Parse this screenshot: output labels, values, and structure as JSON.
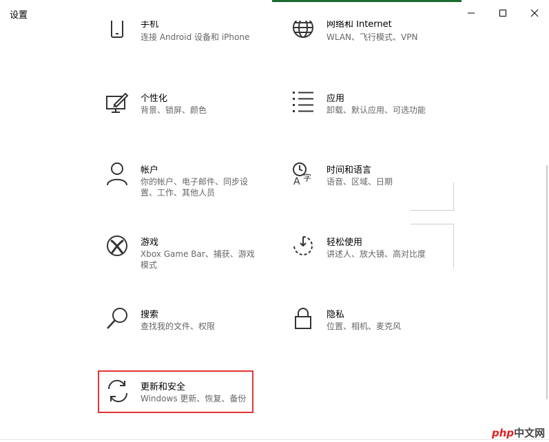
{
  "window": {
    "title": "设置",
    "controls": {
      "minimize": "minimize-icon",
      "maximize": "maximize-icon",
      "close": "close-icon"
    }
  },
  "tiles": [
    {
      "id": "phone",
      "label": "手机",
      "desc": "连接 Android 设备和 iPhone",
      "icon": "phone-icon"
    },
    {
      "id": "network",
      "label": "网络和 Internet",
      "desc": "WLAN、飞行模式、VPN",
      "icon": "globe-icon"
    },
    {
      "id": "personalization",
      "label": "个性化",
      "desc": "背景、锁屏、颜色",
      "icon": "personalization-icon"
    },
    {
      "id": "apps",
      "label": "应用",
      "desc": "卸载、默认应用、可选功能",
      "icon": "apps-list-icon"
    },
    {
      "id": "accounts",
      "label": "帐户",
      "desc": "你的帐户、电子邮件、同步设置、工作、其他人员",
      "icon": "person-icon"
    },
    {
      "id": "time-language",
      "label": "时间和语言",
      "desc": "语音、区域、日期",
      "icon": "time-language-icon"
    },
    {
      "id": "gaming",
      "label": "游戏",
      "desc": "Xbox Game Bar、捕获、游戏模式",
      "icon": "xbox-icon"
    },
    {
      "id": "ease-of-access",
      "label": "轻松使用",
      "desc": "讲述人、放大镜、高对比度",
      "icon": "ease-of-access-icon"
    },
    {
      "id": "search",
      "label": "搜索",
      "desc": "查找我的文件、权限",
      "icon": "search-icon"
    },
    {
      "id": "privacy",
      "label": "隐私",
      "desc": "位置、相机、麦克风",
      "icon": "lock-icon"
    },
    {
      "id": "update-security",
      "label": "更新和安全",
      "desc": "Windows 更新、恢复、备份",
      "icon": "sync-icon"
    }
  ],
  "highlighted_tile": "update-security",
  "watermark": {
    "part1": "php",
    "part2": "中文网"
  },
  "colors": {
    "highlight_border": "#e53333",
    "title_strip": "#1e6b2f",
    "desc_text": "#666666"
  }
}
